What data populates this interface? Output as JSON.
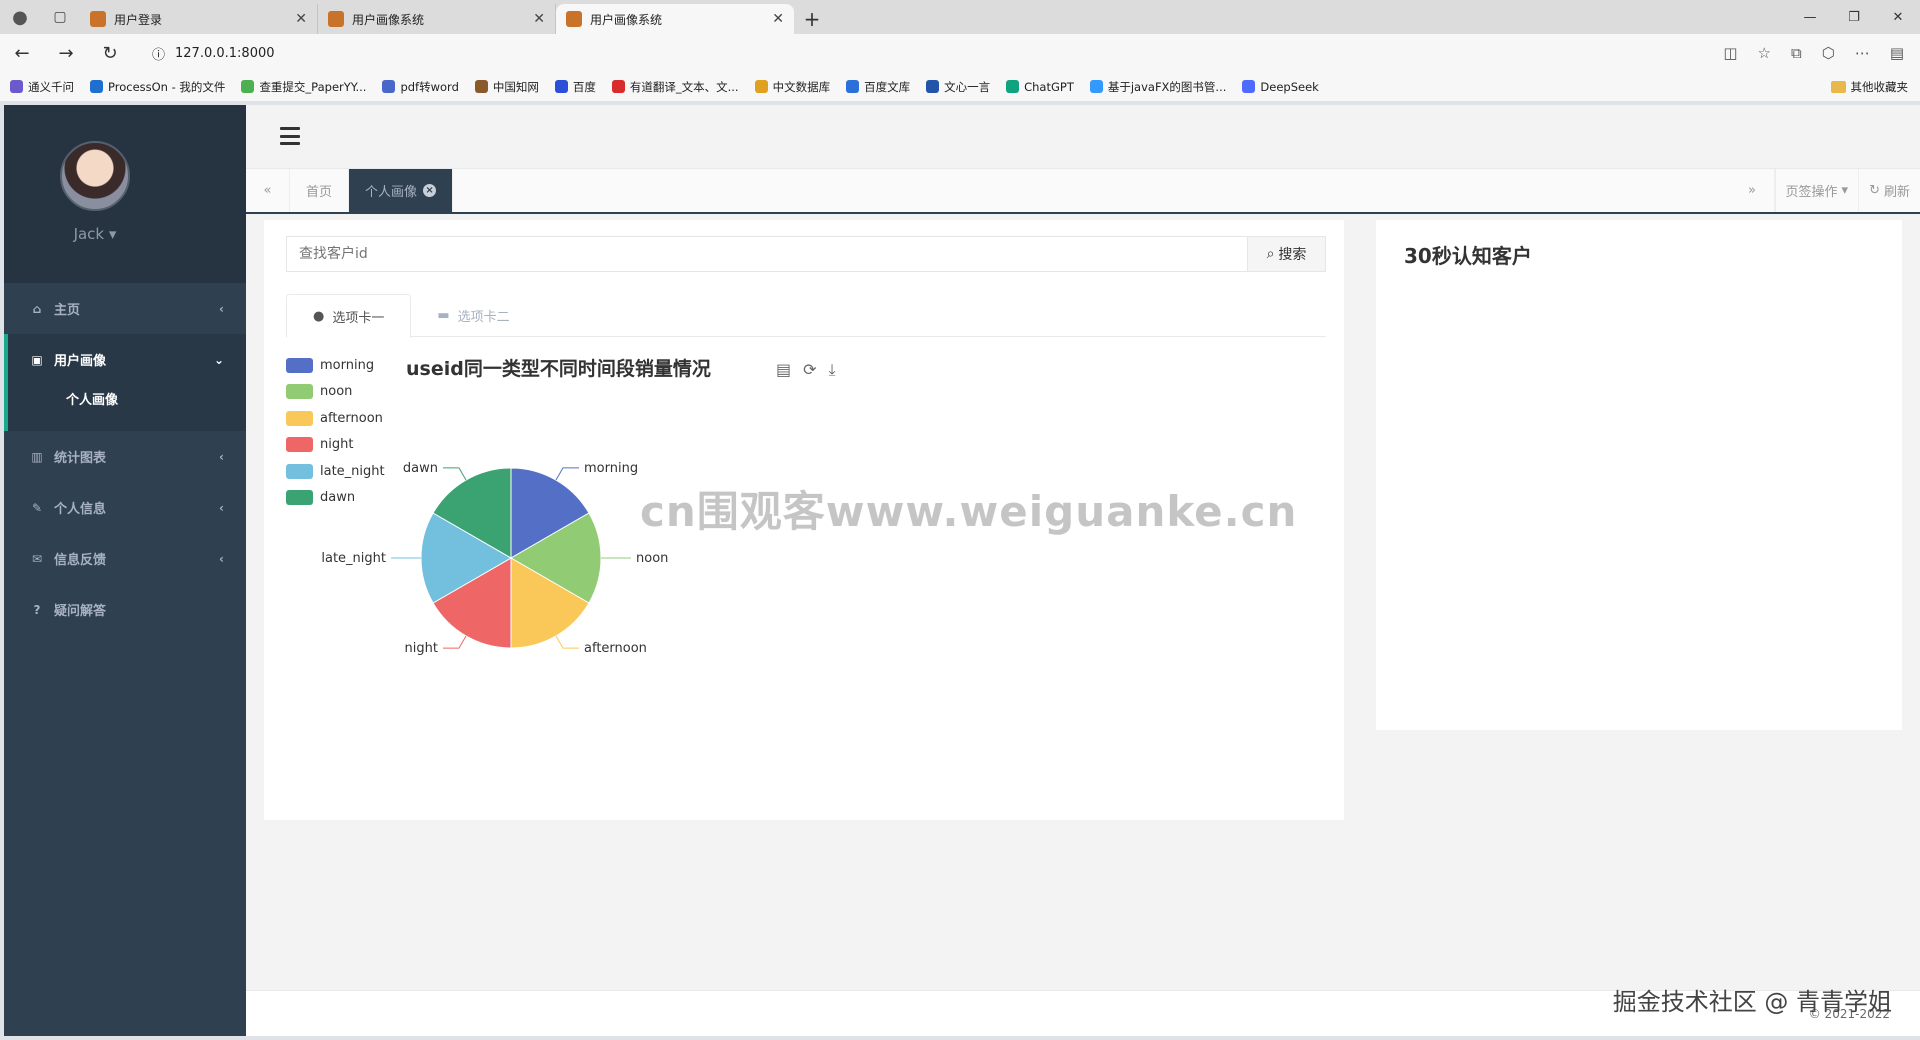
{
  "browser": {
    "tabs": [
      {
        "title": "用户登录",
        "active": false
      },
      {
        "title": "用户画像系统",
        "active": false
      },
      {
        "title": "用户画像系统",
        "active": true
      }
    ],
    "url": "127.0.0.1:8000",
    "bookmarks": [
      {
        "label": "通义千问",
        "color": "#6a5acd"
      },
      {
        "label": "ProcessOn - 我的文件",
        "color": "#1f6fd1"
      },
      {
        "label": "查重提交_PaperYY...",
        "color": "#4caf50"
      },
      {
        "label": "pdf转word",
        "color": "#4a68c9"
      },
      {
        "label": "中国知网",
        "color": "#8b5a2b"
      },
      {
        "label": "百度",
        "color": "#2b4fd8"
      },
      {
        "label": "有道翻译_文本、文...",
        "color": "#d92b2b"
      },
      {
        "label": "中文数据库",
        "color": "#e0a020"
      },
      {
        "label": "百度文库",
        "color": "#2b6fd8"
      },
      {
        "label": "文心一言",
        "color": "#2255aa"
      },
      {
        "label": "ChatGPT",
        "color": "#10a37f"
      },
      {
        "label": "基于javaFX的图书管...",
        "color": "#3399ff"
      },
      {
        "label": "DeepSeek",
        "color": "#4d6bfe"
      }
    ],
    "other_bookmarks": "其他收藏夹"
  },
  "sidebar": {
    "user_name": "Jack",
    "items": [
      {
        "label": "主页",
        "icon": "home-icon",
        "glyph": "⌂"
      },
      {
        "label": "用户画像",
        "icon": "image-icon",
        "glyph": "▣"
      },
      {
        "label": "统计图表",
        "icon": "bar-chart-icon",
        "glyph": "▥"
      },
      {
        "label": "个人信息",
        "icon": "edit-icon",
        "glyph": "✎"
      },
      {
        "label": "信息反馈",
        "icon": "envelope-icon",
        "glyph": "✉"
      },
      {
        "label": "疑问解答",
        "icon": "question-icon",
        "glyph": "?"
      }
    ],
    "sub_item": "个人画像"
  },
  "page_tabs": {
    "home": "首页",
    "current": "个人画像",
    "tab_ops": "页签操作",
    "refresh": "刷新"
  },
  "search": {
    "placeholder": "查找客户id",
    "button": "搜索"
  },
  "content_tabs": [
    "选项卡一",
    "选项卡二"
  ],
  "right_panel_title": "30秒认知客户",
  "footer": {
    "copyright": "© 2021-2022"
  },
  "watermark": "cn围观客www.weiguanke.cn",
  "author_mark": "掘金技术社区 @ 青青学姐",
  "chart_data": {
    "type": "pie",
    "title": "useid同一类型不同时间段销量情况",
    "categories": [
      "morning",
      "noon",
      "afternoon",
      "night",
      "late_night",
      "dawn"
    ],
    "values": [
      1,
      1,
      1,
      1,
      1,
      1
    ],
    "colors": [
      "#5470c6",
      "#91cc75",
      "#fac858",
      "#ee6666",
      "#73c0de",
      "#3ba272"
    ],
    "legend_position": "left"
  }
}
